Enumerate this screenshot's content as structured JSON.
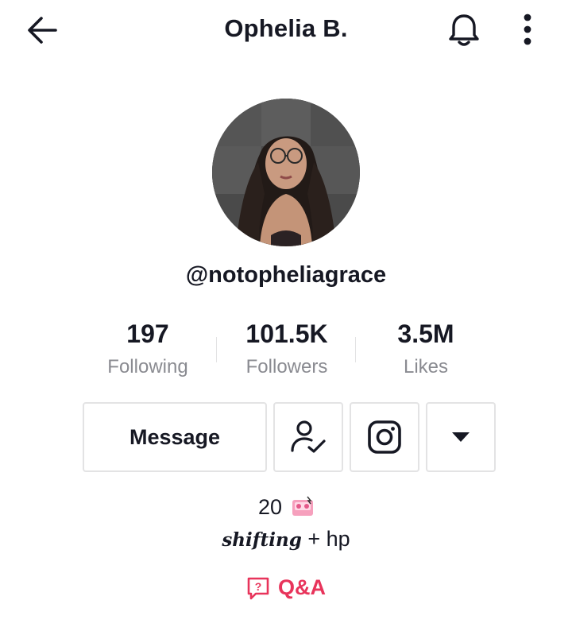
{
  "header": {
    "title": "Ophelia B.",
    "back_icon": "arrow-left-icon",
    "bell_icon": "bell-icon",
    "more_icon": "more-vertical-icon"
  },
  "profile": {
    "handle": "@notopheliagrace",
    "avatar": "profile-photo"
  },
  "stats": [
    {
      "value": "197",
      "label": "Following"
    },
    {
      "value": "101.5K",
      "label": "Followers"
    },
    {
      "value": "3.5M",
      "label": "Likes"
    }
  ],
  "actions": {
    "message_label": "Message",
    "friend_icon": "user-check-icon",
    "instagram_icon": "instagram-icon",
    "dropdown_icon": "caret-down-icon"
  },
  "bio": {
    "line1_text": "20",
    "line1_emoji": "cassette-emoji",
    "line2_script": "shifting",
    "line2_rest": "+ hp"
  },
  "qa": {
    "label": "Q&A",
    "icon": "question-bubble-icon",
    "color": "#e8345b"
  },
  "colors": {
    "text": "#161823",
    "muted": "#8a8b91",
    "border": "#e3e3e4",
    "accent": "#e8345b"
  }
}
